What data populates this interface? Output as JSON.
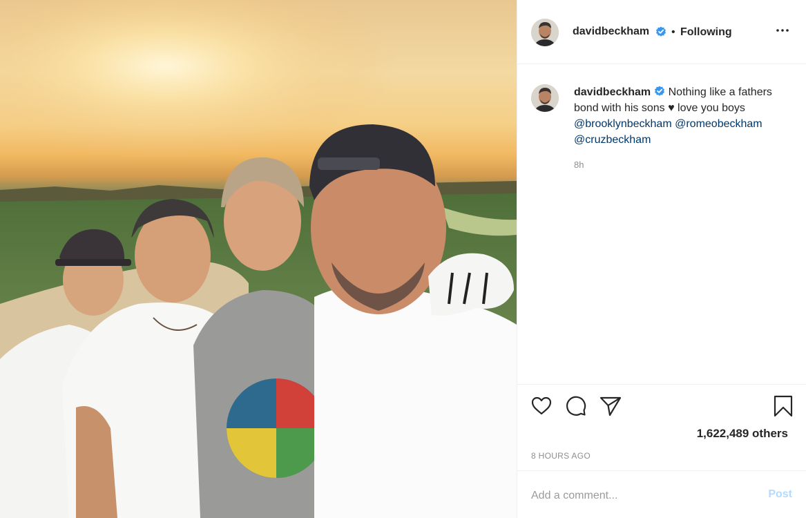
{
  "post": {
    "image_alt": "selfie of four people at sunset on a golf course"
  },
  "header": {
    "username": "davidbeckham",
    "separator": "•",
    "follow_status": "Following"
  },
  "caption": {
    "username": "davidbeckham",
    "text_before": "Nothing like a fathers bond with his sons ♥ love you boys",
    "mentions": [
      "@brooklynbeckham",
      "@romeobeckham",
      "@cruzbeckham"
    ],
    "age": "8h"
  },
  "actions": {
    "likes": "1,622,489 others",
    "timestamp": "8 HOURS AGO"
  },
  "comment": {
    "placeholder": "Add a comment...",
    "post_label": "Post"
  },
  "icons": {
    "verified": "verified-badge-icon",
    "more": "more-options-icon",
    "like": "heart-icon",
    "comment": "comment-bubble-icon",
    "share": "paper-plane-icon",
    "save": "bookmark-icon"
  },
  "colors": {
    "verified_blue": "#3897f0",
    "mention": "#00376b",
    "post_disabled": "#b3dbff"
  }
}
